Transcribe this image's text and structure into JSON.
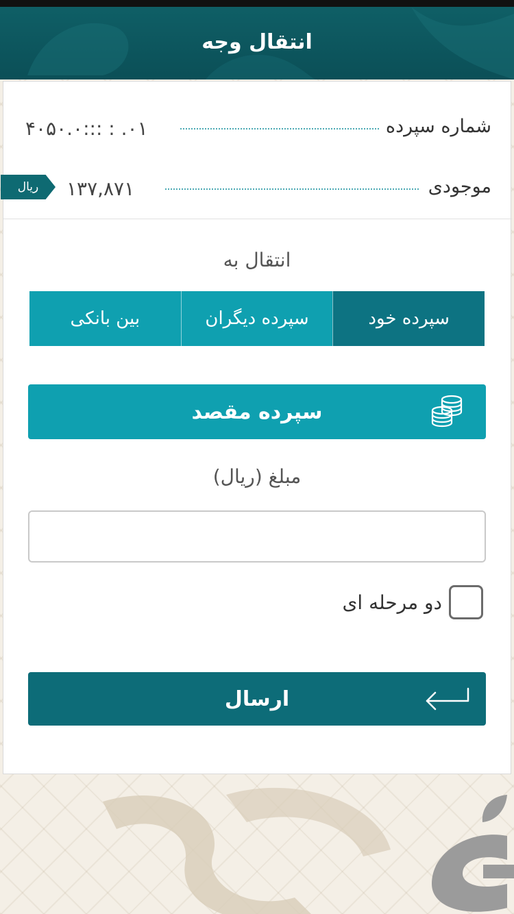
{
  "header": {
    "title": "انتقال وجه"
  },
  "account": {
    "number_label": "شماره سپرده",
    "number_value": "۴۰۵۰.۰:::  :  .۰۱",
    "balance_label": "موجودی",
    "balance_value": "۱۳۷,۸۷۱",
    "balance_unit": "ریال"
  },
  "transfer": {
    "section_title": "انتقال به",
    "tabs": [
      {
        "label": "سپرده خود",
        "active": true
      },
      {
        "label": "سپرده دیگران",
        "active": false
      },
      {
        "label": "بین بانکی",
        "active": false
      }
    ],
    "destination_label": "سپرده مقصد",
    "destination_icon": "coins-stack-icon",
    "amount_label": "مبلغ (ریال)",
    "amount_value": "",
    "two_step_label": "دو مرحله ای",
    "two_step_checked": false,
    "submit_label": "ارسال",
    "submit_icon": "arrow-left-return-icon"
  },
  "colors": {
    "header": "#0b4f57",
    "primary": "#0fa0b0",
    "active_tab": "#0d7382",
    "submit": "#0d6c78",
    "background": "#f4efe6"
  }
}
